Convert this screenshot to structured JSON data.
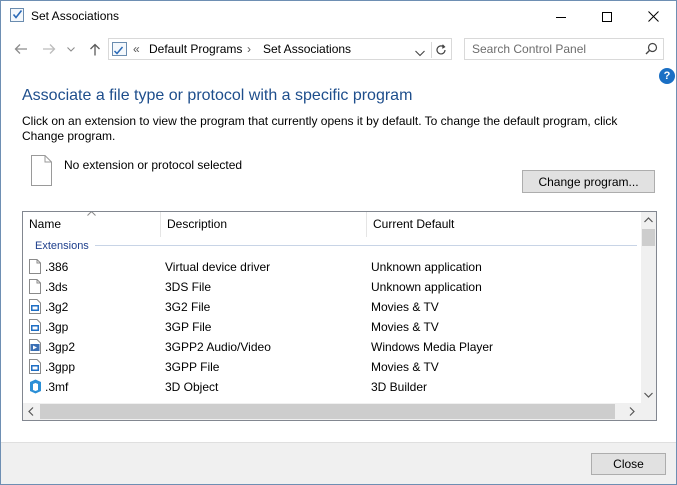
{
  "window": {
    "title": "Set Associations",
    "controls": {
      "minimize": "minimize",
      "maximize": "maximize",
      "close": "close"
    }
  },
  "nav": {
    "breadcrumb_sep": "«",
    "breadcrumb": [
      "Default Programs",
      "Set Associations"
    ],
    "breadcrumb_arrow": "›",
    "search_placeholder": "Search Control Panel"
  },
  "main": {
    "help": "?",
    "heading": "Associate a file type or protocol with a specific program",
    "description": "Click on an extension to view the program that currently opens it by default. To change the default program, click Change program.",
    "selected_text": "No extension or protocol selected",
    "change_button": "Change program..."
  },
  "table": {
    "columns": [
      "Name",
      "Description",
      "Current Default"
    ],
    "group": "Extensions",
    "rows": [
      {
        "name": ".386",
        "desc": "Virtual device driver",
        "default": "Unknown application",
        "icon": "blank-file-icon"
      },
      {
        "name": ".3ds",
        "desc": "3DS File",
        "default": "Unknown application",
        "icon": "blank-file-icon"
      },
      {
        "name": ".3g2",
        "desc": "3G2 File",
        "default": "Movies & TV",
        "icon": "video-file-icon"
      },
      {
        "name": ".3gp",
        "desc": "3GP File",
        "default": "Movies & TV",
        "icon": "video-file-icon"
      },
      {
        "name": ".3gp2",
        "desc": "3GPP2 Audio/Video",
        "default": "Windows Media Player",
        "icon": "media-file-icon"
      },
      {
        "name": ".3gpp",
        "desc": "3GPP File",
        "default": "Movies & TV",
        "icon": "video-file-icon"
      },
      {
        "name": ".3mf",
        "desc": "3D Object",
        "default": "3D Builder",
        "icon": "3d-builder-icon"
      }
    ]
  },
  "footer": {
    "close_button": "Close"
  }
}
